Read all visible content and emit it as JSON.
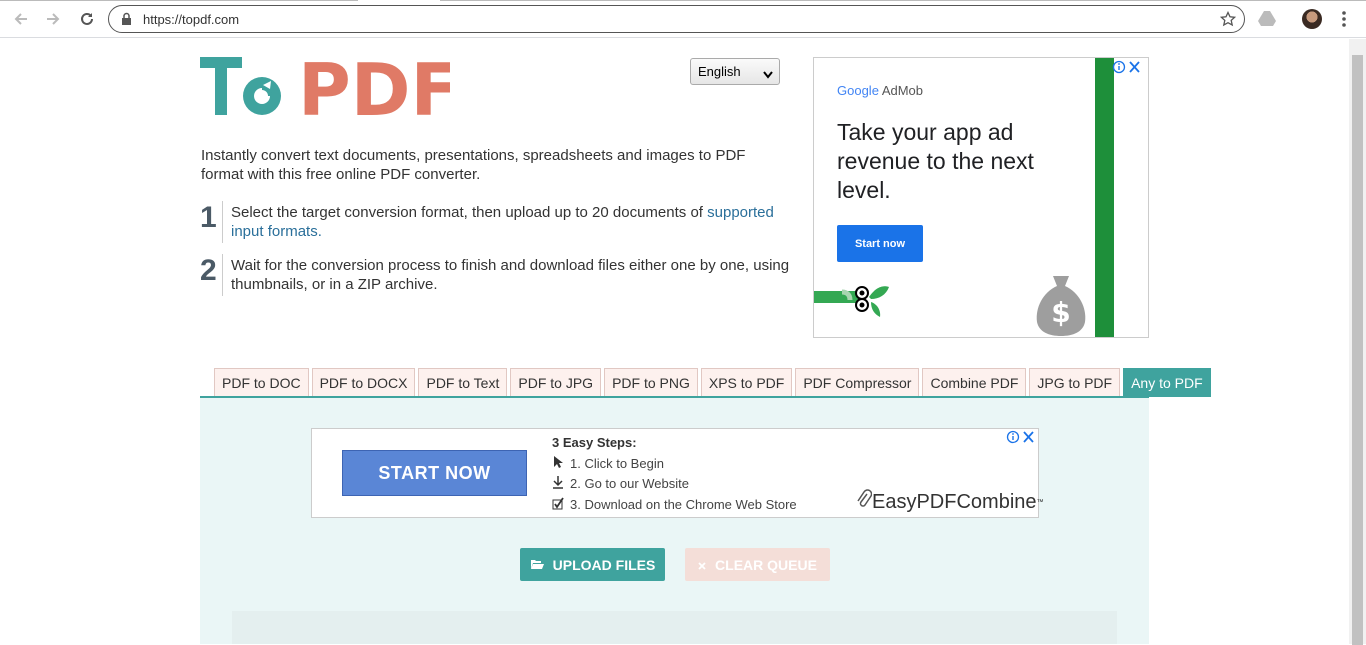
{
  "browser": {
    "url": "https://topdf.com",
    "icons": [
      "back-icon",
      "forward-icon",
      "reload-icon",
      "lock-icon",
      "bookmark-star-icon",
      "drive-extension-icon",
      "profile-avatar",
      "chrome-menu-icon"
    ]
  },
  "logo": {
    "part1": "To",
    "part2": "PDF"
  },
  "language": {
    "selected": "English"
  },
  "intro": "Instantly convert text documents, presentations, spreadsheets and images to PDF format with this free online PDF converter.",
  "steps": [
    {
      "num": "1",
      "text": "Select the target conversion format, then upload up to 20 documents of ",
      "link": "supported input formats."
    },
    {
      "num": "2",
      "text": "Wait for the conversion process to finish and download files either one by one, using thumbnails, or in a ZIP archive."
    }
  ],
  "ad_right": {
    "brand_google": "Google",
    "brand_admob": "AdMob",
    "headline": "Take your app ad revenue to the next level.",
    "cta": "Start now"
  },
  "tabs": [
    {
      "label": "PDF to DOC",
      "active": false
    },
    {
      "label": "PDF to DOCX",
      "active": false
    },
    {
      "label": "PDF to Text",
      "active": false
    },
    {
      "label": "PDF to JPG",
      "active": false
    },
    {
      "label": "PDF to PNG",
      "active": false
    },
    {
      "label": "XPS to PDF",
      "active": false
    },
    {
      "label": "PDF Compressor",
      "active": false
    },
    {
      "label": "Combine PDF",
      "active": false
    },
    {
      "label": "JPG to PDF",
      "active": false
    },
    {
      "label": "Any to PDF",
      "active": true
    }
  ],
  "ad_mid": {
    "button": "START NOW",
    "title": "3 Easy Steps:",
    "steps": [
      "1. Click to Begin",
      "2. Go to our Website",
      "3. Download on the Chrome Web Store"
    ],
    "brand": "EasyPDFCombine",
    "tm": "™"
  },
  "actions": {
    "upload": "UPLOAD FILES",
    "clear": "CLEAR QUEUE"
  },
  "colors": {
    "teal": "#3fa39e",
    "salmon": "#e07a66",
    "tab_bg": "#fdf1ee",
    "panel_bg": "#eaf6f6"
  }
}
